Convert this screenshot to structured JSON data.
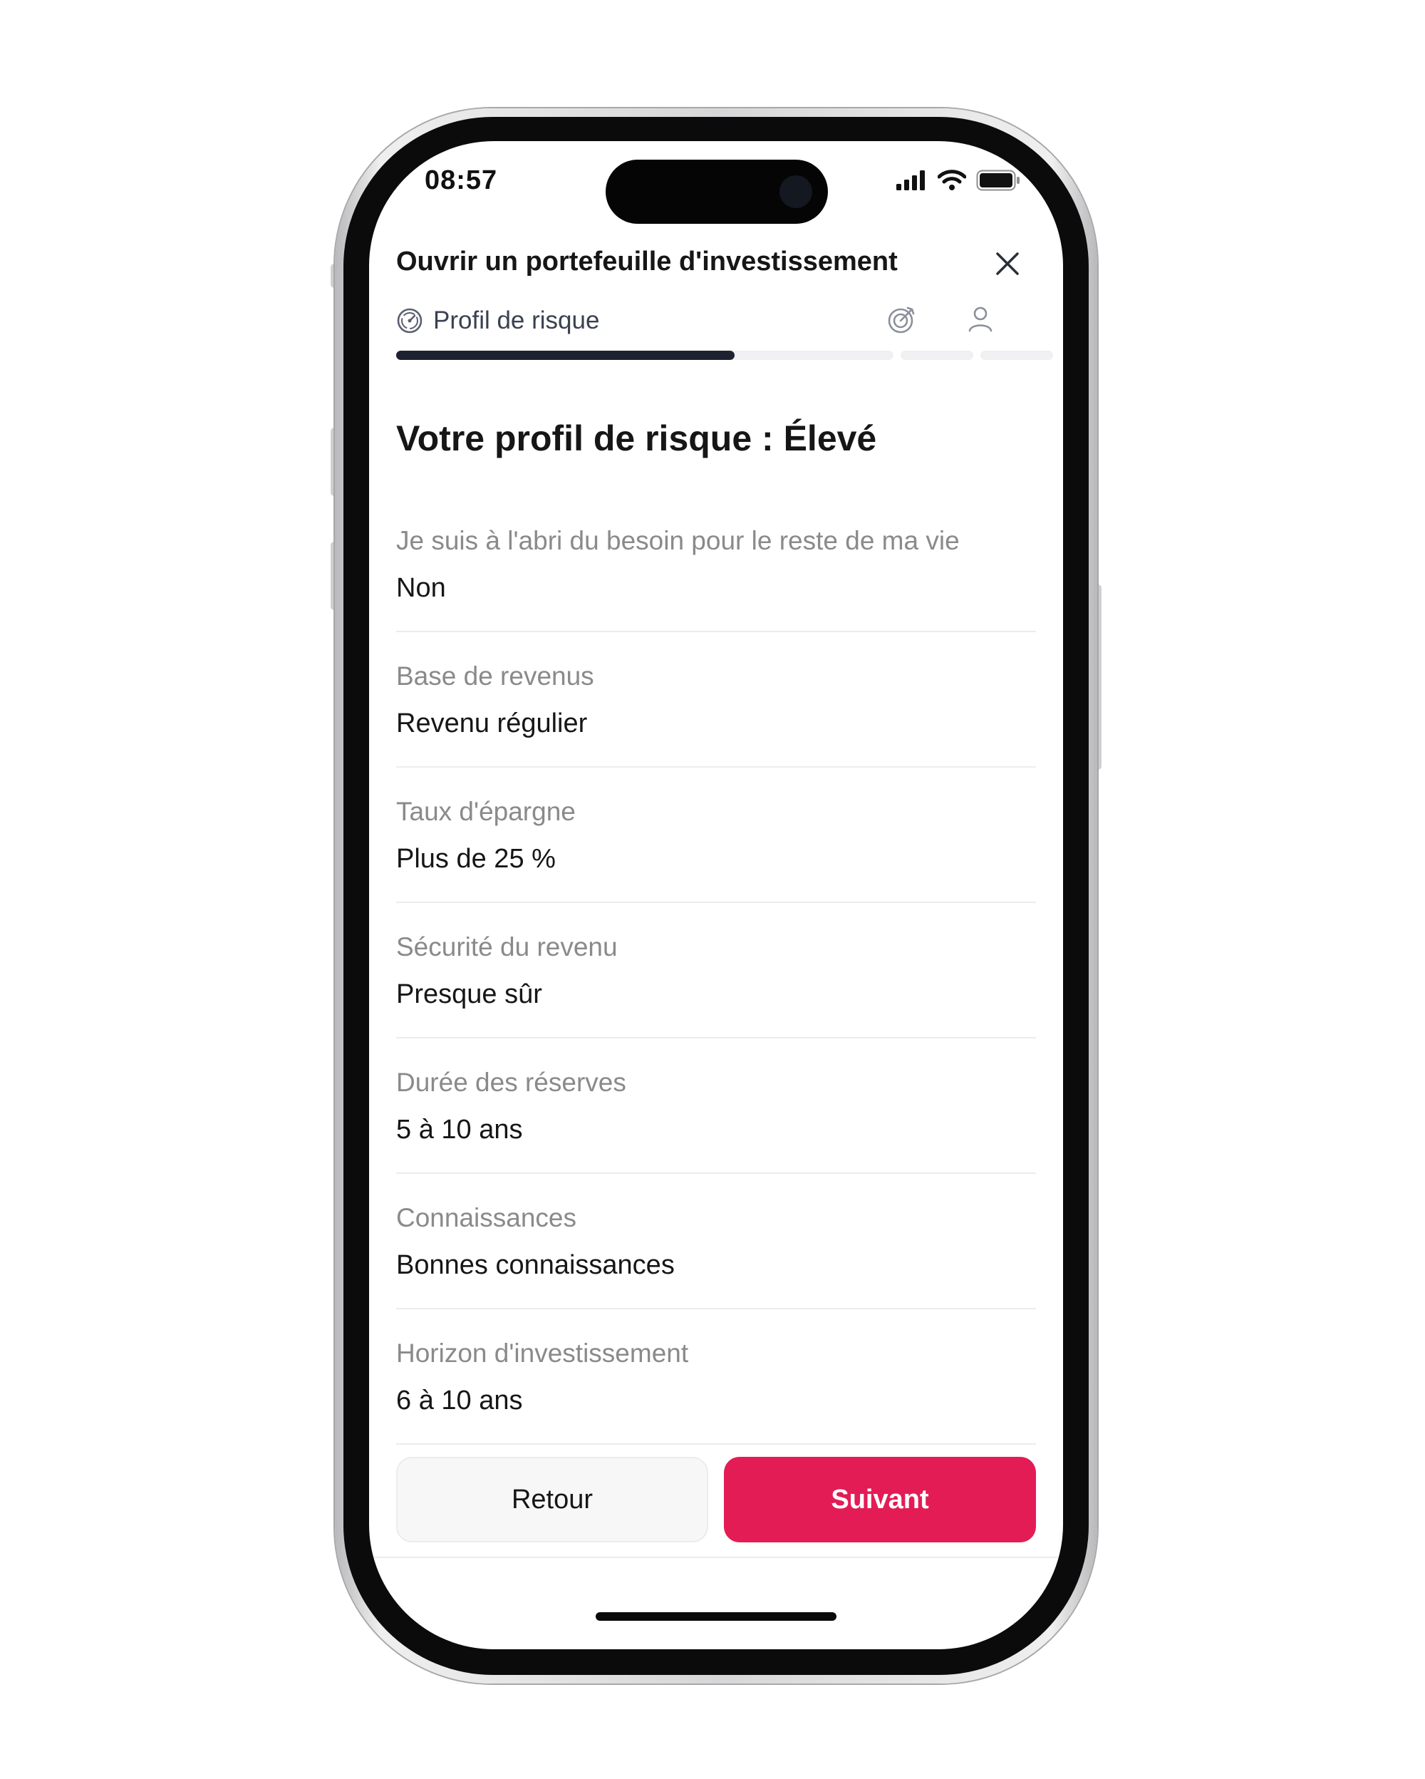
{
  "status_bar": {
    "time": "08:57"
  },
  "header": {
    "title": "Ouvrir un portefeuille d'investissement",
    "close_icon": "close-icon"
  },
  "stepper": {
    "current_step_label": "Profil de risque",
    "current_step_icon": "gauge-icon",
    "next_step_icons": [
      "goal-target-icon",
      "person-icon"
    ],
    "progress_fraction": 0.68,
    "colors": {
      "active": "#1e2230",
      "inactive": "#f0f0f2"
    }
  },
  "main": {
    "heading": "Votre profil de risque : Élevé",
    "rows": [
      {
        "label": "Je suis à l'abri du besoin pour le reste de ma vie",
        "value": "Non"
      },
      {
        "label": "Base de revenus",
        "value": "Revenu régulier"
      },
      {
        "label": "Taux d'épargne",
        "value": "Plus de 25 %"
      },
      {
        "label": "Sécurité du revenu",
        "value": "Presque sûr"
      },
      {
        "label": "Durée des réserves",
        "value": "5 à 10 ans"
      },
      {
        "label": "Connaissances",
        "value": "Bonnes connaissances"
      },
      {
        "label": "Horizon d'investissement",
        "value": "6 à 10 ans"
      }
    ]
  },
  "footer": {
    "back_label": "Retour",
    "next_label": "Suivant",
    "accent_color": "#e31c56"
  }
}
